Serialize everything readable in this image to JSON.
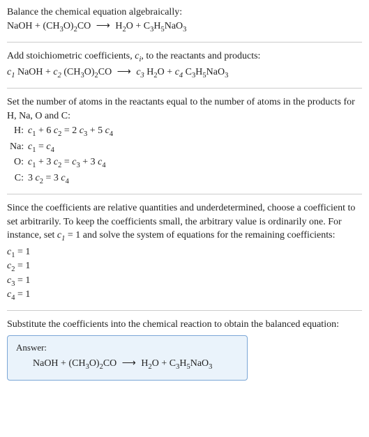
{
  "intro": {
    "line1": "Balance the chemical equation algebraically:",
    "eq_left1": "NaOH + (CH",
    "eq_sub1": "3",
    "eq_left2": "O)",
    "eq_sub2": "2",
    "eq_left3": "CO",
    "arrow": "⟶",
    "eq_right1": "H",
    "eq_rsub1": "2",
    "eq_right2": "O + C",
    "eq_rsub2": "3",
    "eq_right3": "H",
    "eq_rsub3": "5",
    "eq_right4": "NaO",
    "eq_rsub4": "3"
  },
  "step1": {
    "line1a": "Add stoichiometric coefficients, ",
    "line1b": ", to the reactants and products:",
    "ci": "c",
    "ci_sub": "i",
    "c1": "c",
    "c1s": "1",
    "r1": " NaOH + ",
    "c2": "c",
    "c2s": "2",
    "r2a": " (CH",
    "r2sub1": "3",
    "r2b": "O)",
    "r2sub2": "2",
    "r2c": "CO",
    "arrow": "⟶",
    "c3": "c",
    "c3s": "3",
    "r3a": " H",
    "r3sub": "2",
    "r3b": "O + ",
    "c4": "c",
    "c4s": "4",
    "r4a": " C",
    "r4sub1": "3",
    "r4b": "H",
    "r4sub2": "5",
    "r4c": "NaO",
    "r4sub3": "3"
  },
  "step2": {
    "line1": "Set the number of atoms in the reactants equal to the number of atoms in the products for H, Na, O and C:",
    "rows": [
      {
        "label": "H:",
        "pre": "c",
        "s1": "1",
        "mid": " + 6 ",
        "c2": "c",
        "s2": "2",
        "eq": " = 2 ",
        "c3": "c",
        "s3": "3",
        "post": " + 5 ",
        "c4": "c",
        "s4": "4"
      },
      {
        "label": "Na:",
        "pre": "c",
        "s1": "1",
        "mid": "",
        "c2": "",
        "s2": "",
        "eq": " = ",
        "c3": "",
        "s3": "",
        "post": "",
        "c4": "c",
        "s4": "4"
      },
      {
        "label": "O:",
        "pre": "c",
        "s1": "1",
        "mid": " + 3 ",
        "c2": "c",
        "s2": "2",
        "eq": " = ",
        "c3": "c",
        "s3": "3",
        "post": " + 3 ",
        "c4": "c",
        "s4": "4"
      },
      {
        "label": "C:",
        "pre": "3 ",
        "s1": "",
        "mid": "",
        "c2": "c",
        "s2": "2",
        "eq": " = 3 ",
        "c3": "",
        "s3": "",
        "post": "",
        "c4": "c",
        "s4": "4"
      }
    ]
  },
  "step3": {
    "line1": "Since the coefficients are relative quantities and underdetermined, choose a coefficient to set arbitrarily. To keep the coefficients small, the arbitrary value is ordinarily one. For instance, set ",
    "setc": "c",
    "setcs": "1",
    "line1b": " = 1 and solve the system of equations for the remaining coefficients:",
    "coefs": [
      {
        "c": "c",
        "s": "1",
        "v": " = 1"
      },
      {
        "c": "c",
        "s": "2",
        "v": " = 1"
      },
      {
        "c": "c",
        "s": "3",
        "v": " = 1"
      },
      {
        "c": "c",
        "s": "4",
        "v": " = 1"
      }
    ]
  },
  "step4": {
    "line1": "Substitute the coefficients into the chemical reaction to obtain the balanced equation:"
  },
  "answer": {
    "label": "Answer:",
    "eq_left1": "NaOH + (CH",
    "eq_sub1": "3",
    "eq_left2": "O)",
    "eq_sub2": "2",
    "eq_left3": "CO",
    "arrow": "⟶",
    "eq_right1": "H",
    "eq_rsub1": "2",
    "eq_right2": "O + C",
    "eq_rsub2": "3",
    "eq_right3": "H",
    "eq_rsub3": "5",
    "eq_right4": "NaO",
    "eq_rsub4": "3"
  }
}
